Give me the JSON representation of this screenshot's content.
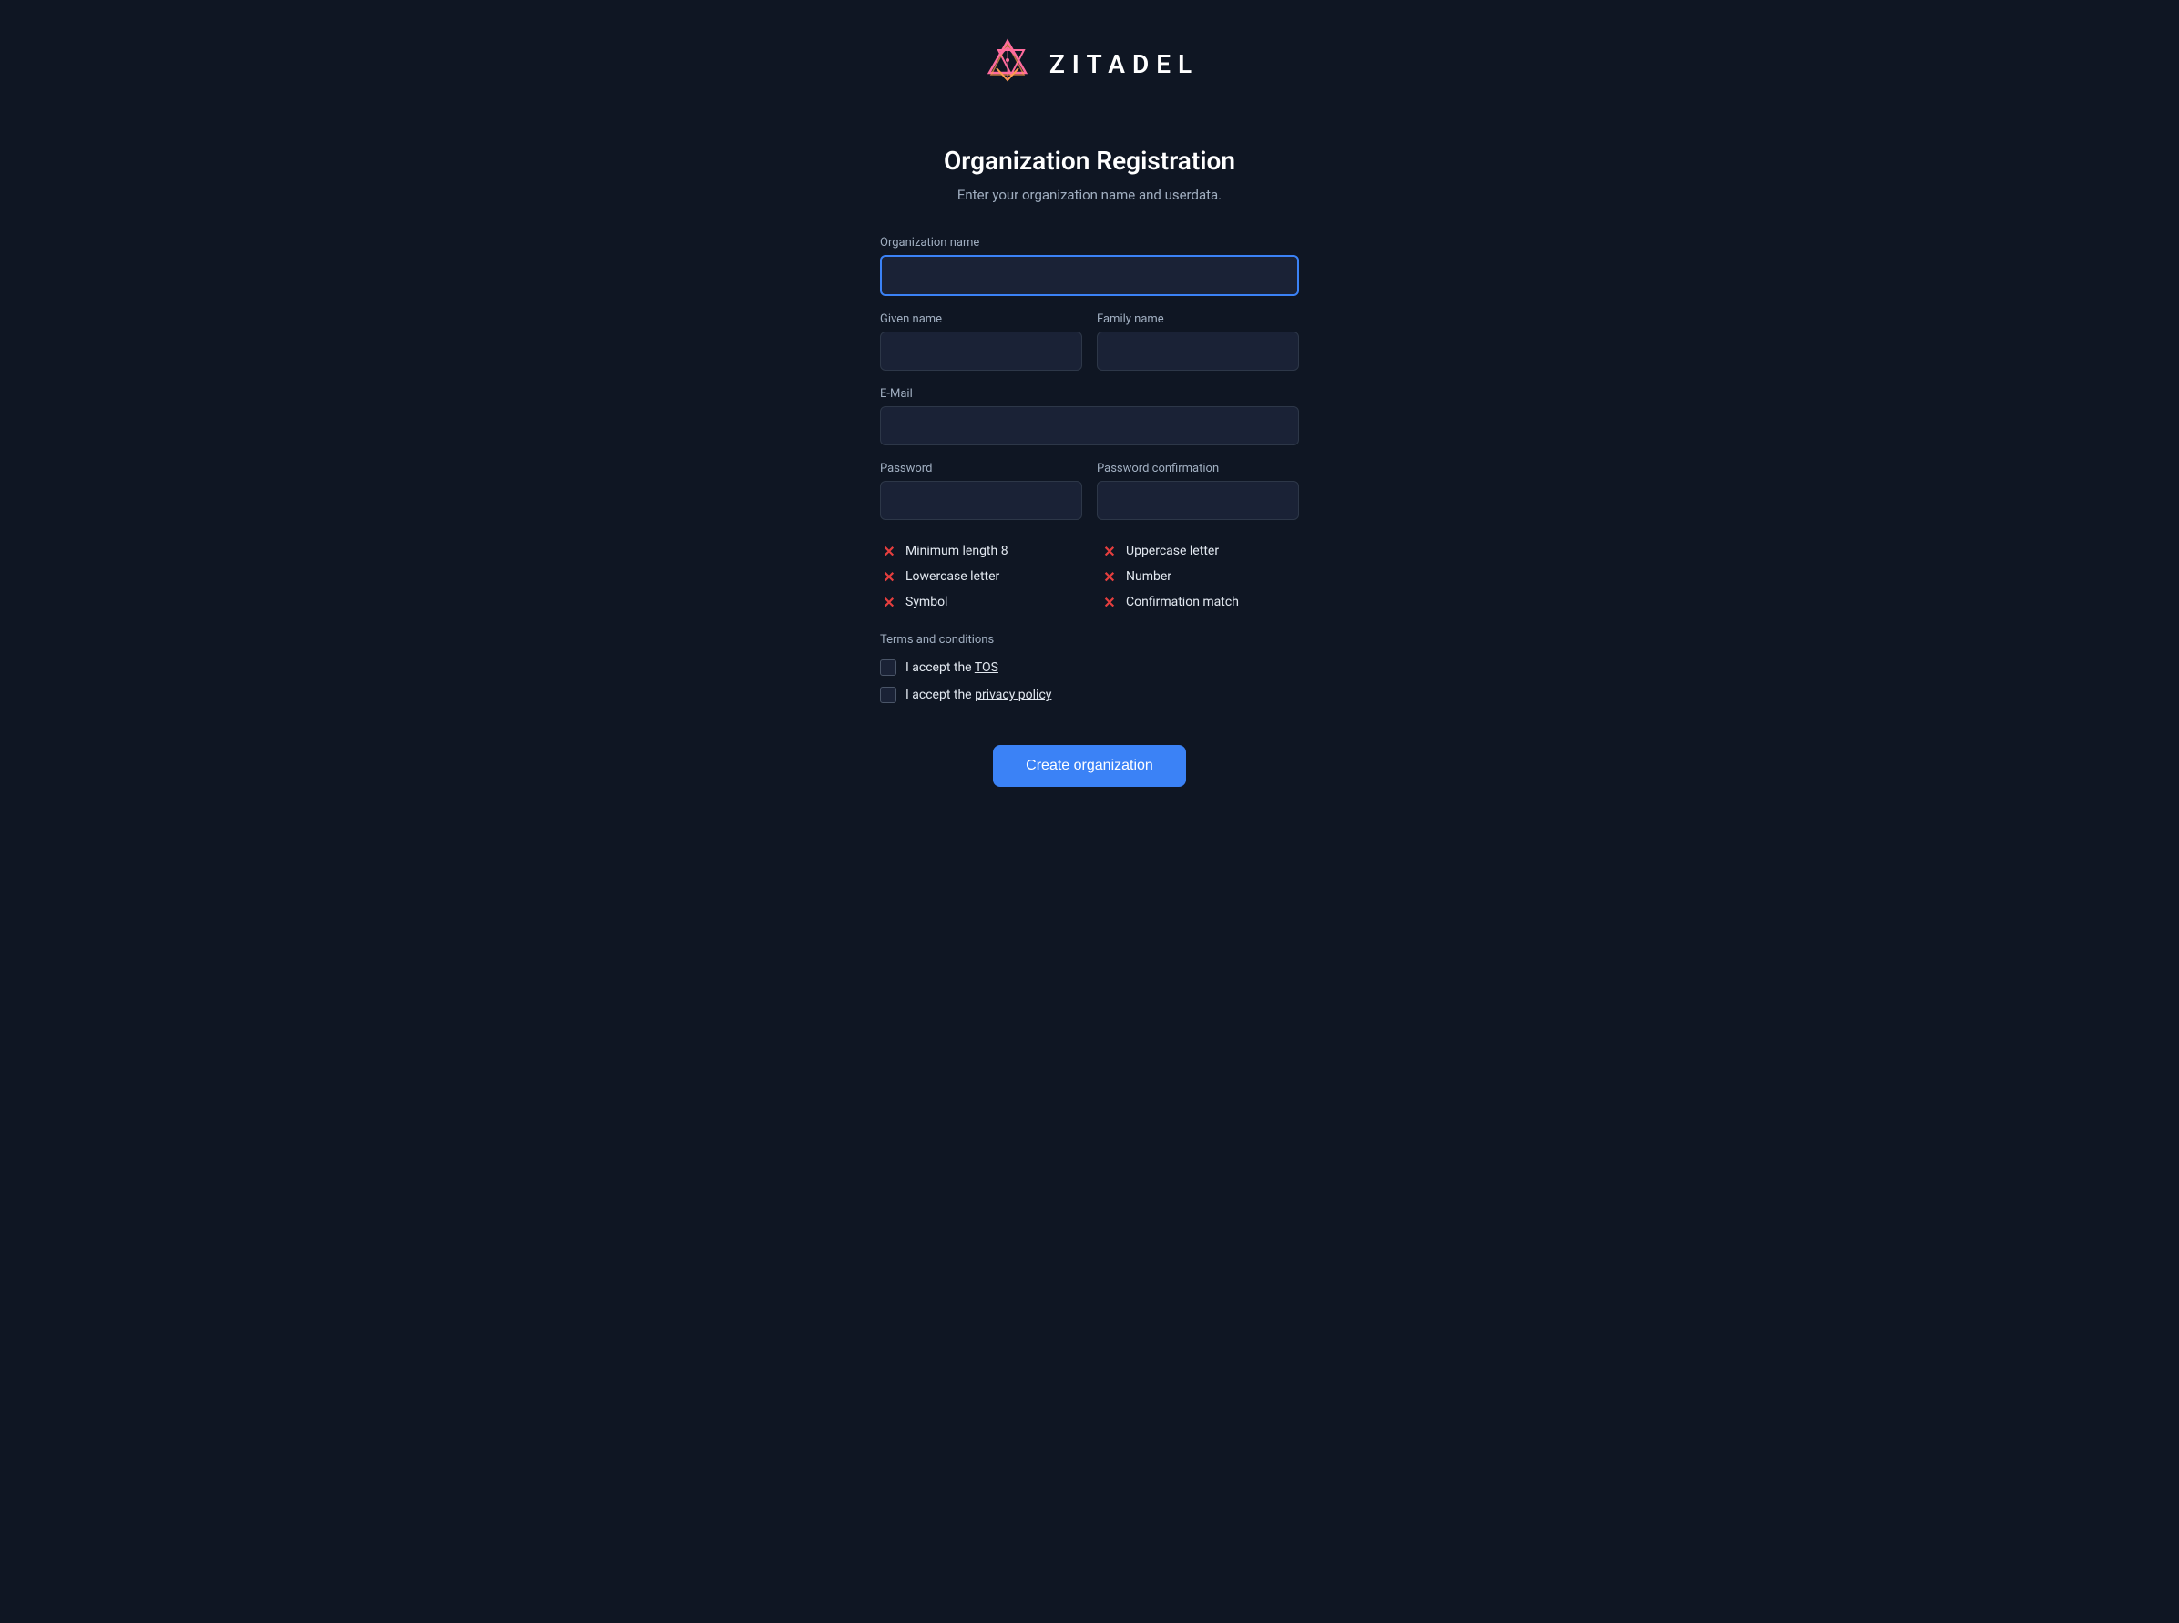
{
  "logo": {
    "text": "ZITADEL"
  },
  "page": {
    "title": "Organization Registration",
    "subtitle": "Enter your organization name and userdata."
  },
  "form": {
    "org_name_label": "Organization name",
    "org_name_placeholder": "",
    "given_name_label": "Given name",
    "given_name_placeholder": "",
    "family_name_label": "Family name",
    "family_name_placeholder": "",
    "email_label": "E-Mail",
    "email_placeholder": "",
    "password_label": "Password",
    "password_placeholder": "",
    "password_confirm_label": "Password confirmation",
    "password_confirm_placeholder": ""
  },
  "validation": {
    "items": [
      {
        "label": "Minimum length 8",
        "col": 0
      },
      {
        "label": "Uppercase letter",
        "col": 1
      },
      {
        "label": "Lowercase letter",
        "col": 0
      },
      {
        "label": "Number",
        "col": 1
      },
      {
        "label": "Symbol",
        "col": 0
      },
      {
        "label": "Confirmation match",
        "col": 1
      }
    ]
  },
  "terms": {
    "section_label": "Terms and conditions",
    "tos_text": "I accept the ",
    "tos_link_text": "TOS",
    "privacy_text": "I accept the ",
    "privacy_link_text": "privacy policy"
  },
  "buttons": {
    "create": "Create organization"
  }
}
